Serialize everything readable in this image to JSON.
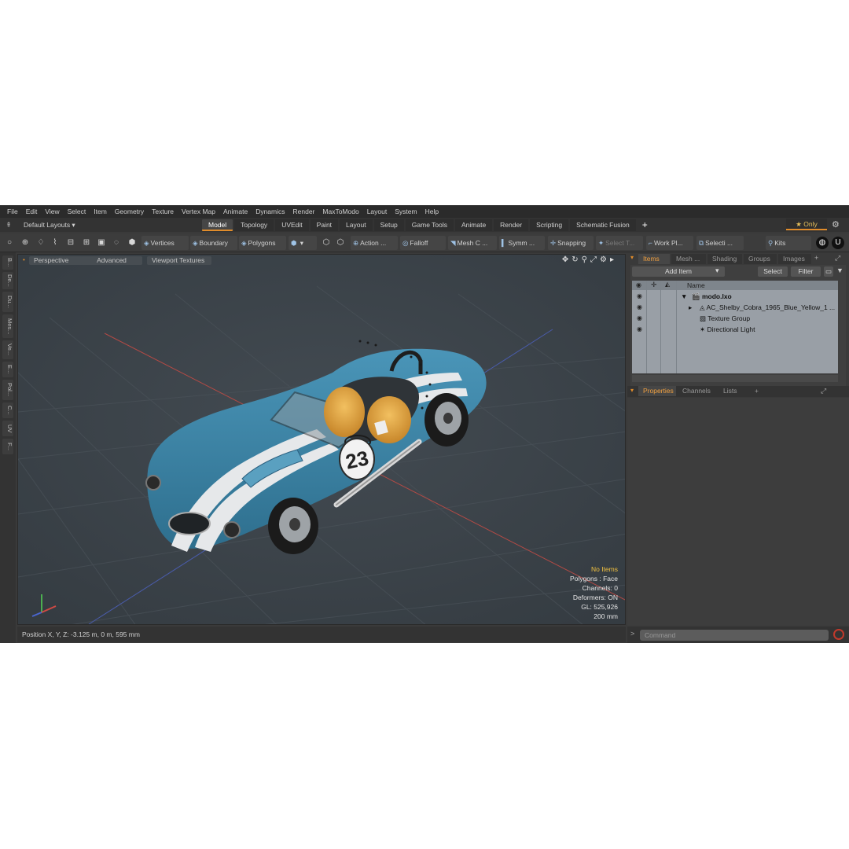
{
  "menu": [
    "File",
    "Edit",
    "View",
    "Select",
    "Item",
    "Geometry",
    "Texture",
    "Vertex Map",
    "Animate",
    "Dynamics",
    "Render",
    "MaxToModo",
    "Layout",
    "System",
    "Help"
  ],
  "layout_menu": {
    "label": "Default Layouts ▾"
  },
  "tabs": [
    "Model",
    "Topology",
    "UVEdit",
    "Paint",
    "Layout",
    "Setup",
    "Game Tools",
    "Animate",
    "Render",
    "Scripting",
    "Schematic Fusion"
  ],
  "active_tab": "Model",
  "only_label": "★ Only",
  "toolbar": {
    "vertices": "Vertices",
    "boundary": "Boundary",
    "polygons": "Polygons",
    "action": "Action ...",
    "falloff": "Falloff",
    "mesh": "Mesh C ...",
    "symm": "Symm ...",
    "snapping": "Snapping",
    "select_t": "Select T...",
    "work_pl": "Work Pl...",
    "selecti": "Selecti ...",
    "kits": "Kits"
  },
  "left_tabs": [
    "B...",
    "De...",
    "Du...",
    "Mes...",
    "Ve...",
    "E...",
    "Pol...",
    "C...",
    "UV",
    "F..."
  ],
  "viewport": {
    "perspective": "Perspective",
    "advanced": "Advanced",
    "viewport_textures": "Viewport Textures",
    "car_number": "23",
    "stats": {
      "items": "No Items",
      "polygons": "Polygons : Face",
      "channels": "Channels: 0",
      "deformers": "Deformers: ON",
      "gl": "GL: 525,926",
      "scale": "200 mm"
    }
  },
  "status": {
    "position": "Position X, Y, Z:   -3.125 m, 0 m, 595 mm"
  },
  "right_panel": {
    "tabs": [
      "Items",
      "Mesh ...",
      "Shading",
      "Groups",
      "Images"
    ],
    "add_item": "Add Item",
    "select": "Select",
    "filter": "Filter",
    "name_header": "Name",
    "tree": [
      {
        "label": "modo.lxo"
      },
      {
        "label": "AC_Shelby_Cobra_1965_Blue_Yellow_1 ..."
      },
      {
        "label": "Texture Group"
      },
      {
        "label": "Directional Light"
      }
    ],
    "prop_tabs": [
      "Properties",
      "Channels",
      "Lists",
      "+"
    ],
    "command_placeholder": "Command"
  },
  "colors": {
    "accent": "#e08c2b",
    "car_body": "#3d86a8",
    "stripe": "#e6e8ea",
    "seat": "#e2a63a"
  }
}
